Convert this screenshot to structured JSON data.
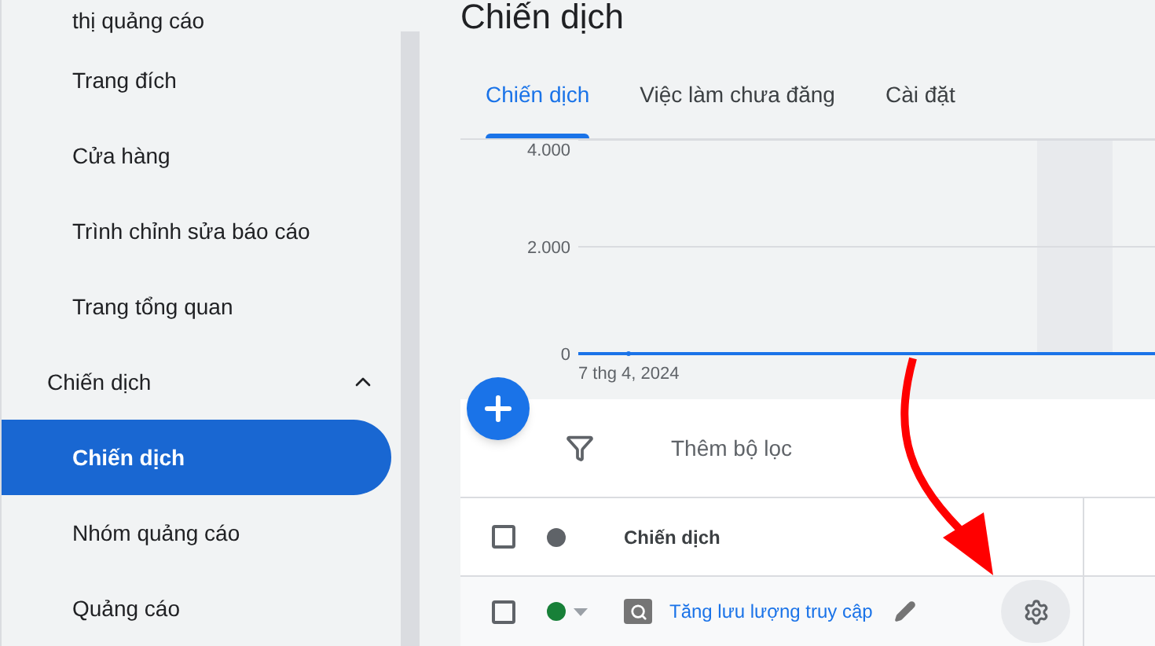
{
  "sidebar": {
    "items": [
      {
        "label": "thị quảng cáo",
        "kind": "item",
        "selected": false
      },
      {
        "label": "Trang đích",
        "kind": "item",
        "selected": false
      },
      {
        "label": "Cửa hàng",
        "kind": "item",
        "selected": false
      },
      {
        "label": "Trình chỉnh sửa báo cáo",
        "kind": "item",
        "selected": false
      },
      {
        "label": "Trang tổng quan",
        "kind": "item",
        "selected": false
      },
      {
        "label": "Chiến dịch",
        "kind": "group",
        "expanded": true,
        "children": [
          {
            "label": "Chiến dịch",
            "selected": true
          },
          {
            "label": "Nhóm quảng cáo",
            "selected": false
          },
          {
            "label": "Quảng cáo",
            "selected": false
          }
        ]
      }
    ]
  },
  "page_title": "Chiến dịch",
  "tabs": [
    {
      "label": "Chiến dịch",
      "selected": true
    },
    {
      "label": "Việc làm chưa đăng",
      "selected": false
    },
    {
      "label": "Cài đặt",
      "selected": false
    }
  ],
  "chart": {
    "chart_data": {
      "type": "line",
      "x": [
        "7 thg 4, 2024"
      ],
      "ylim": [
        0,
        4000
      ],
      "yticks": [
        {
          "value": 0,
          "label": "0"
        },
        {
          "value": 2000,
          "label": "2.000"
        },
        {
          "value": 4000,
          "label": "4.000"
        }
      ],
      "series": [
        {
          "color": "#1a73e8",
          "marker": "dot",
          "values": [
            0
          ]
        }
      ]
    }
  },
  "filter": {
    "label": "Thêm bộ lọc"
  },
  "table": {
    "select_all_checked": false,
    "columns": [
      {
        "label": "Chiến dịch"
      }
    ],
    "rows": [
      {
        "name": "Tăng lưu lượng truy cập",
        "checked": false,
        "color": "#188038"
      }
    ]
  }
}
